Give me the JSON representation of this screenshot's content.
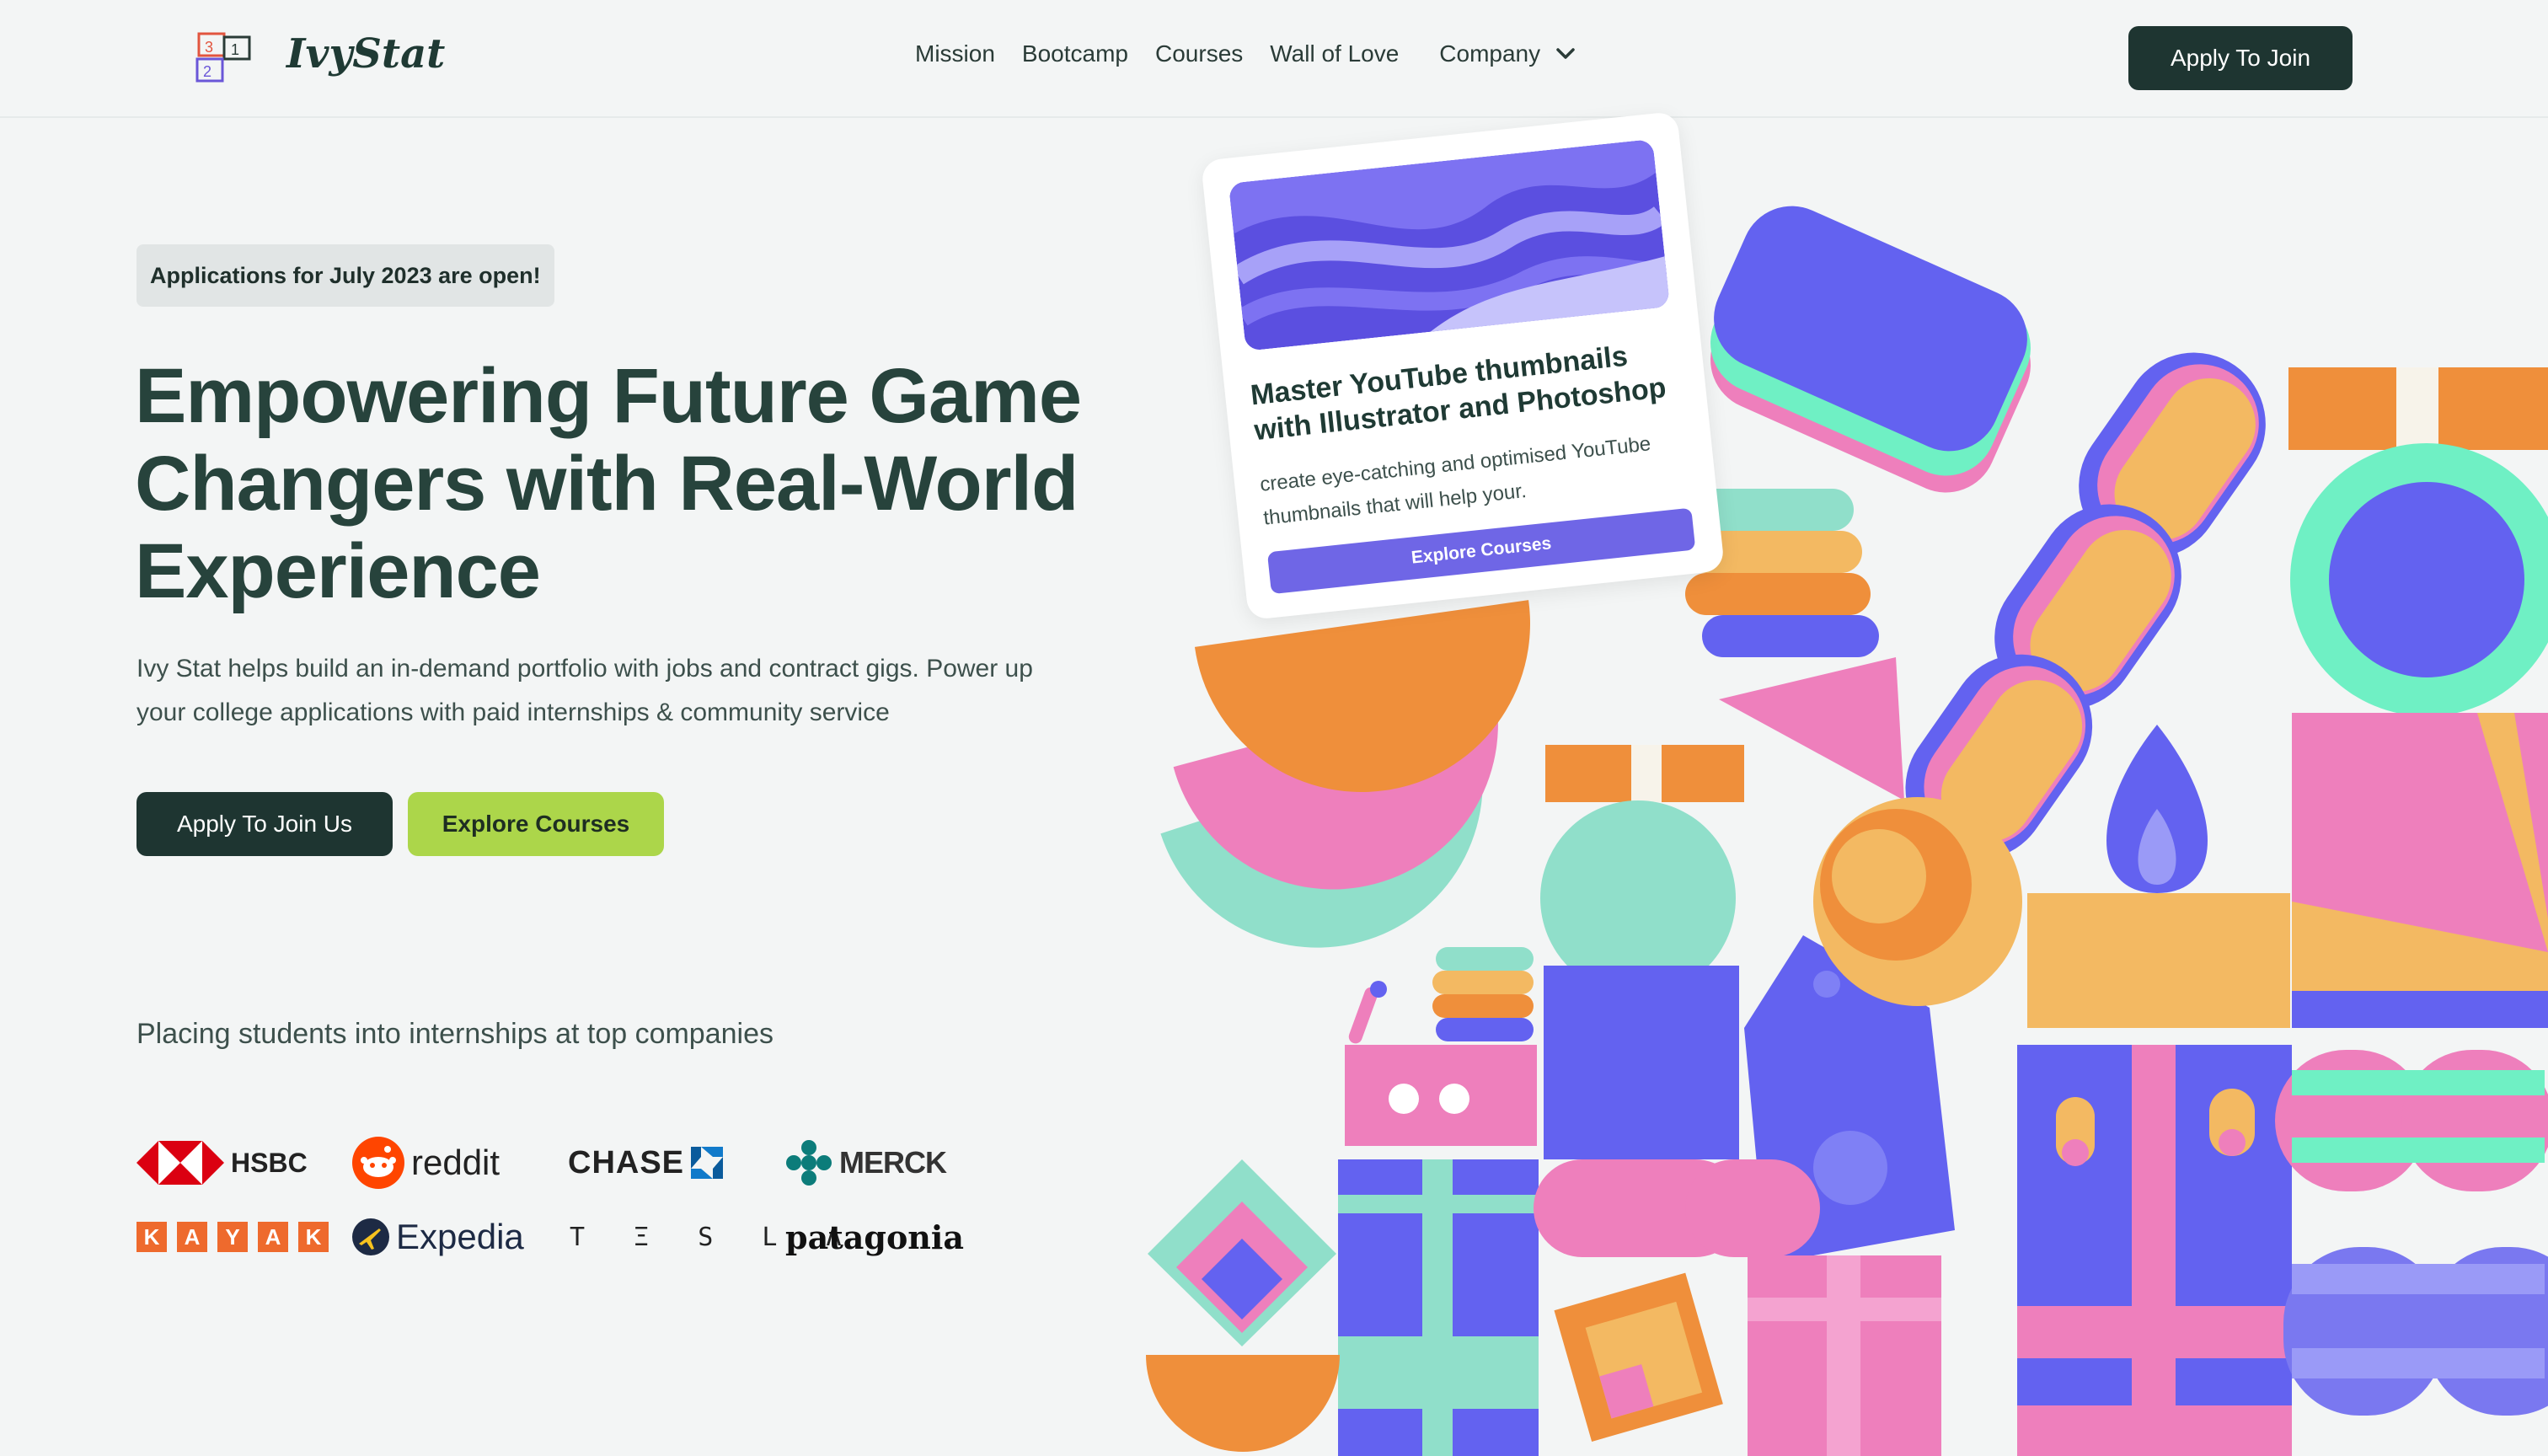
{
  "brand": {
    "name": "IvyStat",
    "logo_icon": "number-blocks-icon",
    "block_numbers": [
      "3",
      "1",
      "2"
    ]
  },
  "nav": {
    "items": [
      "Mission",
      "Bootcamp",
      "Courses",
      "Wall of Love"
    ],
    "company_label": "Company",
    "cta": "Apply To Join"
  },
  "hero": {
    "badge": "Applications for July 2023 are open!",
    "headline": "Empowering Future Game Changers with Real-World Experience",
    "subtext": "Ivy Stat helps build an in-demand portfolio with jobs and contract gigs. Power up your college applications with paid internships & community service",
    "primary_button": "Apply To Join Us",
    "secondary_button": "Explore Courses"
  },
  "companies": {
    "heading": "Placing students into internships at top companies",
    "logos": [
      {
        "name": "HSBC",
        "icon": "hsbc-hexagon-icon"
      },
      {
        "name": "reddit",
        "icon": "reddit-alien-icon"
      },
      {
        "name": "CHASE",
        "icon": "chase-octagon-icon"
      },
      {
        "name": "MERCK",
        "icon": "merck-icon"
      },
      {
        "name": "KAYAK",
        "letters": [
          "K",
          "A",
          "Y",
          "A",
          "K"
        ]
      },
      {
        "name": "Expedia",
        "icon": "expedia-plane-icon"
      },
      {
        "name": "TESLA",
        "display": "T Ξ S L Λ"
      },
      {
        "name": "patagonia"
      }
    ]
  },
  "card": {
    "title": "Master YouTube thumbnails with Illustrator and Photoshop",
    "description": "create eye-catching and optimised YouTube thumbnails that will help your.",
    "button": "Explore Courses"
  },
  "colors": {
    "primary_dark": "#1e3531",
    "accent_green": "#acd64a",
    "purple": "#6362f0",
    "pink": "#ee7fbc",
    "orange": "#ef8f3b",
    "mint": "#90dfca",
    "yellow": "#f3b962"
  }
}
